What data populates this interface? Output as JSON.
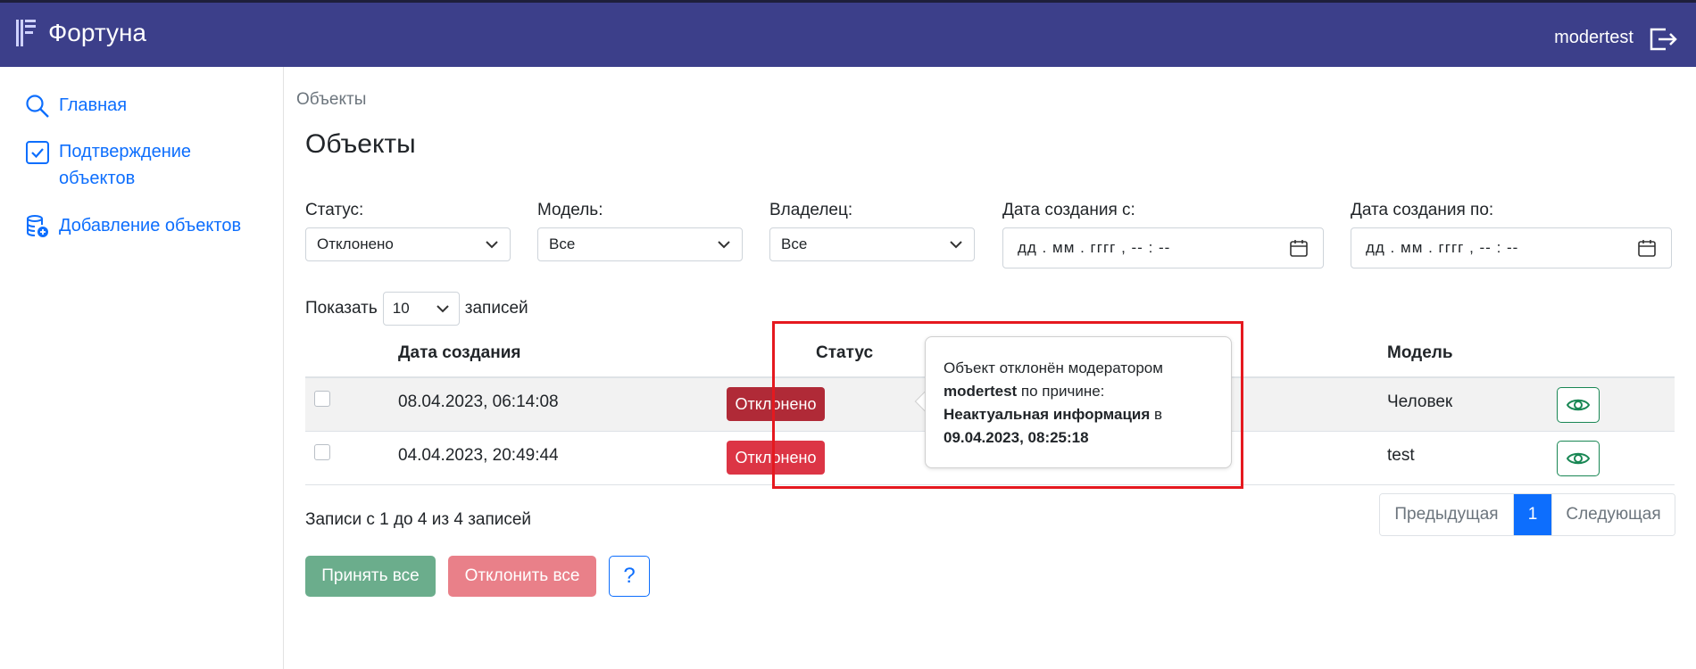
{
  "app": {
    "name": "Фортуна",
    "user": "modertest"
  },
  "sidebar": {
    "items": [
      {
        "label": "Главная",
        "icon": "search-icon"
      },
      {
        "label": "Подтверждение объектов",
        "icon": "checkbox-icon"
      },
      {
        "label": "Добавление объектов",
        "icon": "database-add-icon"
      }
    ]
  },
  "breadcrumb": "Объекты",
  "page_title": "Объекты",
  "filters": {
    "status": {
      "label": "Статус:",
      "value": "Отклонено"
    },
    "model": {
      "label": "Модель:",
      "value": "Все"
    },
    "owner": {
      "label": "Владелец:",
      "value": "Все"
    },
    "date_from": {
      "label": "Дата создания с:",
      "placeholder": "дд . мм . гггг ,  -- : --"
    },
    "date_to": {
      "label": "Дата создания по:",
      "placeholder": "дд . мм . гггг ,  -- : --"
    }
  },
  "length": {
    "prefix": "Показать",
    "value": "10",
    "suffix": "записей"
  },
  "table": {
    "headers": {
      "date": "Дата создания",
      "status": "Статус",
      "model": "Модель"
    },
    "rows": [
      {
        "date": "08.04.2023, 06:14:08",
        "status": "Отклонено",
        "model": "Человек"
      },
      {
        "date": "04.04.2023, 20:49:44",
        "status": "Отклонено",
        "model": "test"
      }
    ]
  },
  "tooltip": {
    "line1": "Объект отклонён модератором",
    "moderator": "modertest",
    "by_reason": "по причине:",
    "reason": "Неактуальная информация",
    "at": "в",
    "datetime": "09.04.2023, 08:25:18"
  },
  "info": "Записи с 1 до 4 из 4 записей",
  "pagination": {
    "prev": "Предыдущая",
    "current": "1",
    "next": "Следующая"
  },
  "actions": {
    "accept_all": "Принять все",
    "reject_all": "Отклонить все",
    "help": "?"
  },
  "colors": {
    "header": "#3c3f8a",
    "link": "#0d6efd",
    "danger": "#dc3545",
    "success": "#198754",
    "highlight": "#e5191f"
  }
}
